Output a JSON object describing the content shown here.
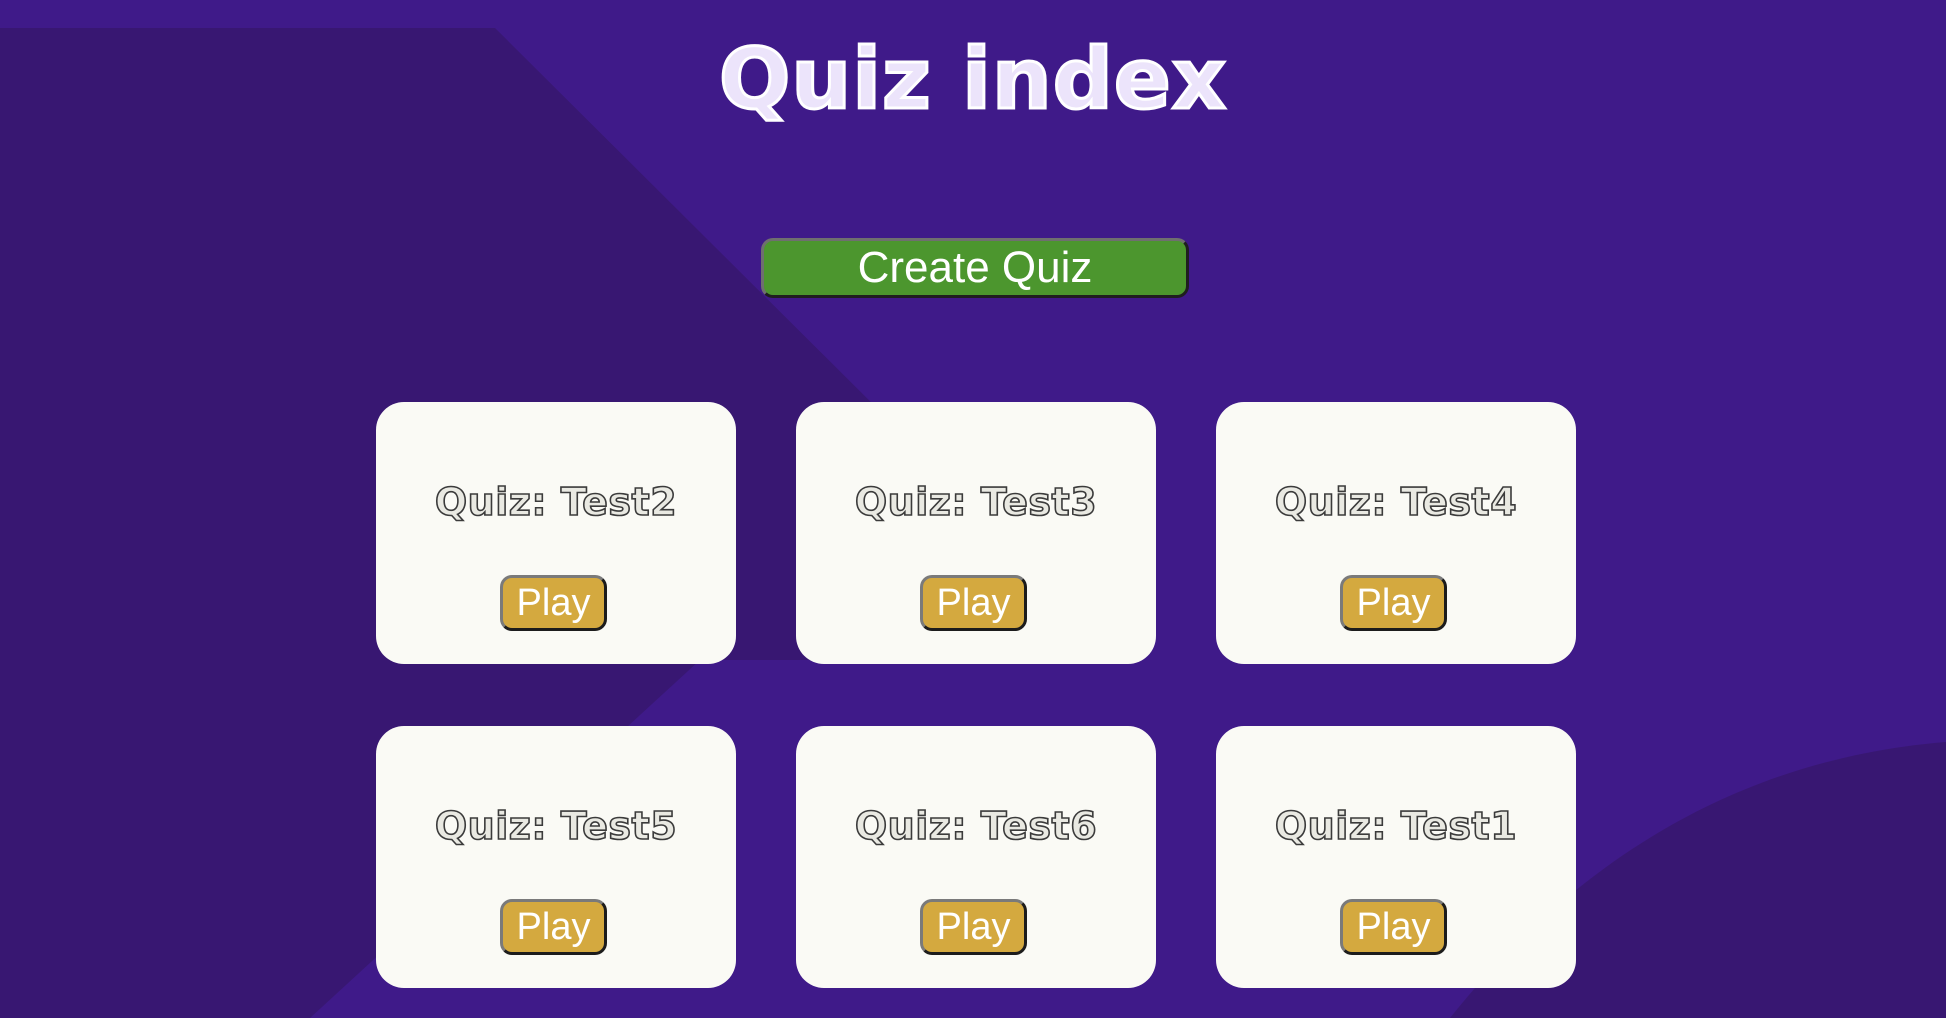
{
  "header": {
    "title": "Quiz index"
  },
  "actions": {
    "create_label": "Create Quiz"
  },
  "quizzes": [
    {
      "title": "Quiz: Test2",
      "play_label": "Play"
    },
    {
      "title": "Quiz: Test3",
      "play_label": "Play"
    },
    {
      "title": "Quiz: Test4",
      "play_label": "Play"
    },
    {
      "title": "Quiz: Test5",
      "play_label": "Play"
    },
    {
      "title": "Quiz: Test6",
      "play_label": "Play"
    },
    {
      "title": "Quiz: Test1",
      "play_label": "Play"
    }
  ],
  "colors": {
    "background": "#3f1a89",
    "background_shade": "#351670",
    "create_button": "#4c962e",
    "play_button": "#d4a93f",
    "card": "#fafaf5"
  }
}
